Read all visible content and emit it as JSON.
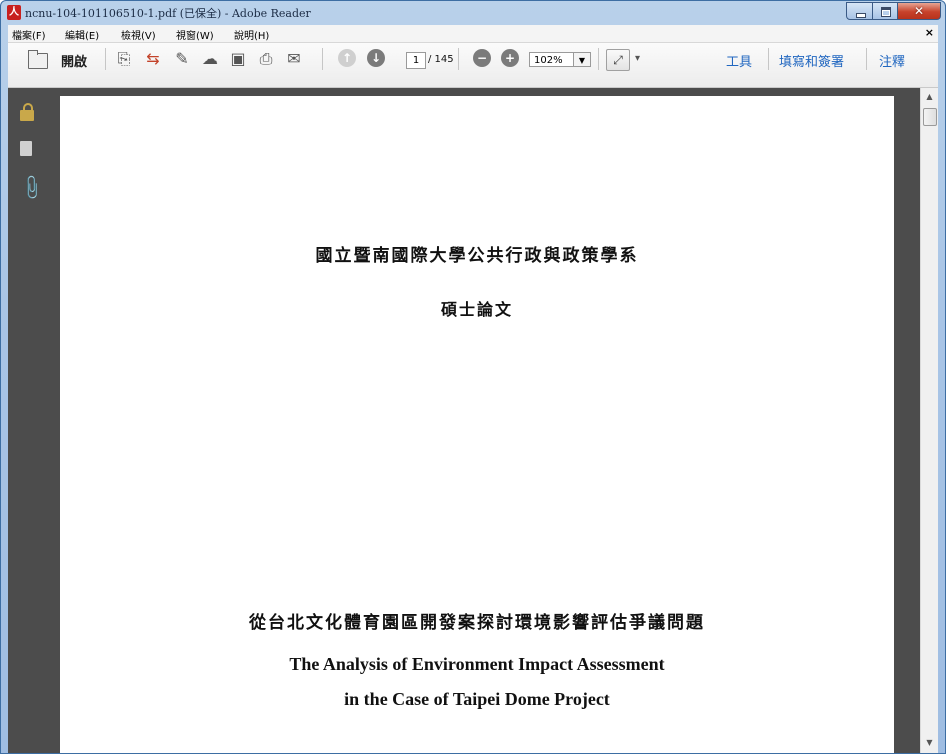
{
  "window": {
    "title": "ncnu-104-101106510-1.pdf (已保全) - Adobe Reader",
    "app_icon": "adobe-reader-icon"
  },
  "menu": {
    "items": [
      "檔案(F)",
      "編輯(E)",
      "檢視(V)",
      "視窗(W)",
      "說明(H)"
    ],
    "close_glyph": "×"
  },
  "toolbar": {
    "open_label": "開啟",
    "page_current": "1",
    "page_total": "/ 145",
    "zoom": "102%",
    "tools_label": "工具",
    "fill_sign_label": "填寫和簽署",
    "comment_label": "注釋"
  },
  "document": {
    "university": "國立暨南國際大學公共行政與政策學系",
    "degree": "碩士論文",
    "title_zh": "從台北文化體育園區開發案探討環境影響評估爭議問題",
    "title_en_line1": "The Analysis of Environment Impact Assessment",
    "title_en_line2": "in the Case of Taipei Dome Project"
  },
  "colors": {
    "title_bar": "#a9c5e6",
    "accent_link": "#2167c0",
    "panel_gray": "#4c4c4c",
    "close_red": "#c7422b"
  }
}
